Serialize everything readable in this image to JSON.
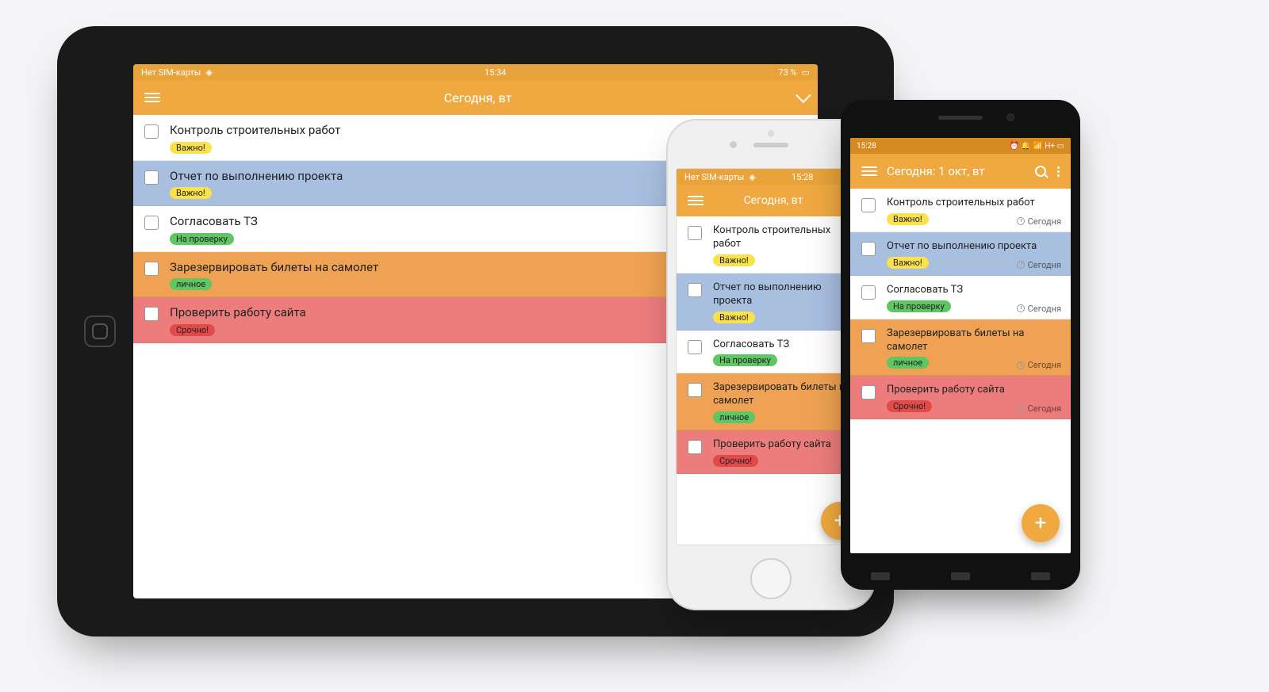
{
  "tablet": {
    "status_left": "Нет SIM-карты",
    "status_time": "15:34",
    "status_right": "73 %",
    "header_title": "Сегодня, вт",
    "tasks": [
      {
        "title": "Контроль строительных работ",
        "tag": "Важно!",
        "tag_class": "tag-yellow",
        "bg": "bg-white"
      },
      {
        "title": "Отчет по выполнению проекта",
        "tag": "Важно!",
        "tag_class": "tag-yellow",
        "bg": "bg-blue"
      },
      {
        "title": "Согласовать ТЗ",
        "tag": "На проверку",
        "tag_class": "tag-green",
        "bg": "bg-white"
      },
      {
        "title": "Зарезервировать билеты на самолет",
        "tag": "личное",
        "tag_class": "tag-greenlt",
        "bg": "bg-orange"
      },
      {
        "title": "Проверить работу сайта",
        "tag": "Срочно!",
        "tag_class": "tag-red",
        "bg": "bg-red"
      }
    ]
  },
  "iphone": {
    "status_left": "Нет SIM-карты",
    "status_time": "15:28",
    "header_title": "Сегодня, вт",
    "tasks": [
      {
        "title": "Контроль строительных работ",
        "tag": "Важно!",
        "tag_class": "tag-yellow",
        "bg": "bg-white"
      },
      {
        "title": "Отчет по выполнению проекта",
        "tag": "Важно!",
        "tag_class": "tag-yellow",
        "bg": "bg-blue"
      },
      {
        "title": "Согласовать ТЗ",
        "tag": "На проверку",
        "tag_class": "tag-green",
        "bg": "bg-white"
      },
      {
        "title": "Зарезервировать билеты на самолет",
        "tag": "личное",
        "tag_class": "tag-greenlt",
        "bg": "bg-orange"
      },
      {
        "title": "Проверить работу сайта",
        "tag": "Срочно!",
        "tag_class": "tag-red",
        "bg": "bg-red"
      }
    ]
  },
  "android": {
    "status_time": "15:28",
    "status_right": "H+",
    "header_title": "Сегодня: 1 окт, вт",
    "due_text": "Сегодня",
    "tasks": [
      {
        "title": "Контроль строительных работ",
        "tag": "Важно!",
        "tag_class": "tag-yellow",
        "bg": "bg-white"
      },
      {
        "title": "Отчет по выполнению проекта",
        "tag": "Важно!",
        "tag_class": "tag-yellow",
        "bg": "bg-blue"
      },
      {
        "title": "Согласовать ТЗ",
        "tag": "На проверку",
        "tag_class": "tag-green",
        "bg": "bg-white"
      },
      {
        "title": "Зарезервировать билеты на самолет",
        "tag": "личное",
        "tag_class": "tag-greenlt",
        "bg": "bg-orange"
      },
      {
        "title": "Проверить работу сайта",
        "tag": "Срочно!",
        "tag_class": "tag-red",
        "bg": "bg-red"
      }
    ]
  },
  "fab_label": "+"
}
